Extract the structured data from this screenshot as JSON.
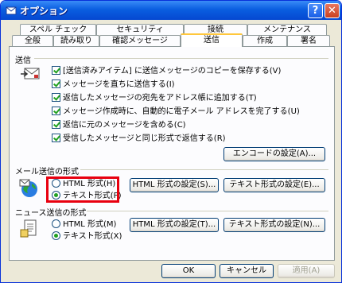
{
  "window": {
    "title": "オプション",
    "help_label": "?",
    "close_label": "✕"
  },
  "tabs": {
    "row1": [
      "スペル チェック",
      "セキュリティ",
      "接続",
      "メンテナンス"
    ],
    "row2": [
      "全般",
      "読み取り",
      "確認メッセージ",
      "送信",
      "作成",
      "署名"
    ],
    "active": "送信"
  },
  "send": {
    "title": "送信",
    "options": [
      "[送信済みアイテム] に送信メッセージのコピーを保存する(V)",
      "メッセージを直ちに送信する(I)",
      "返信したメッセージの宛先をアドレス帳に追加する(T)",
      "メッセージ作成時に、自動的に電子メール アドレスを完了する(U)",
      "返信に元のメッセージを含める(C)",
      "受信したメッセージと同じ形式で返信する(R)"
    ],
    "encode_button": "エンコードの設定(A)..."
  },
  "mail_format": {
    "title": "メール送信の形式",
    "html_label": "HTML 形式(H)",
    "text_label": "テキスト形式(P)",
    "selected": "テキスト形式(P)",
    "html_settings_button": "HTML 形式の設定(S)...",
    "text_settings_button": "テキスト形式の設定(E)..."
  },
  "news_format": {
    "title": "ニュース送信の形式",
    "html_label": "HTML 形式(M)",
    "text_label": "テキスト形式(X)",
    "selected": "テキスト形式(X)",
    "html_settings_button": "HTML 形式の設定(T)...",
    "text_settings_button": "テキスト形式の設定(N)..."
  },
  "footer": {
    "ok": "OK",
    "cancel": "キャンセル",
    "apply": "適用(A)"
  },
  "colors": {
    "highlight": "#e8000f",
    "titlebar": "#0a5ee0",
    "tab_active_border": "#ffc73c"
  }
}
